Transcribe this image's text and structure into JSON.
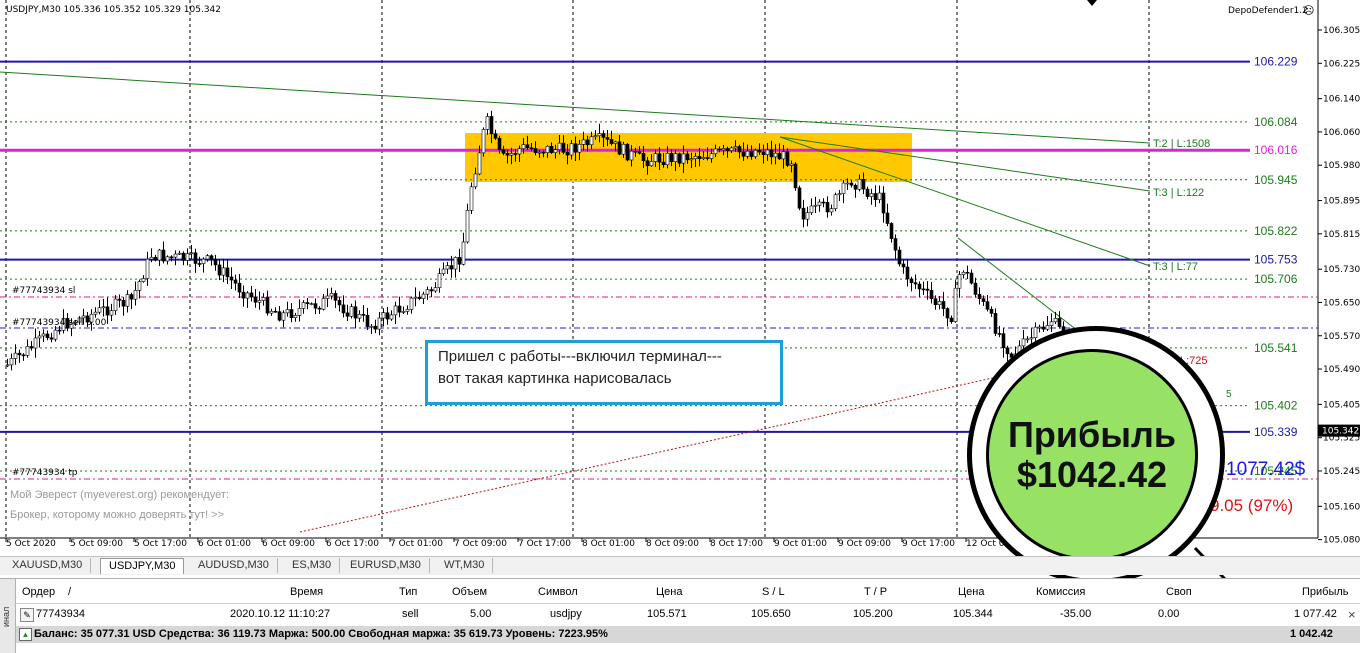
{
  "chart": {
    "header": "USDJPY,M30  105.336 105.352 105.329 105.342",
    "indicator": "DepoDefender1.2",
    "price_ticks": [
      "106.305",
      "106.225",
      "106.140",
      "106.060",
      "105.980",
      "105.895",
      "105.815",
      "105.730",
      "105.650",
      "105.570",
      "105.490",
      "105.405",
      "105.325",
      "105.245",
      "105.160",
      "105.080"
    ],
    "current_price": "105.342",
    "time_ticks": [
      "5 Oct 2020",
      "5 Oct 09:00",
      "5 Oct 17:00",
      "6 Oct 01:00",
      "6 Oct 09:00",
      "6 Oct 17:00",
      "7 Oct 01:00",
      "7 Oct 09:00",
      "7 Oct 17:00",
      "8 Oct 01:00",
      "8 Oct 09:00",
      "8 Oct 17:00",
      "9 Oct 01:00",
      "9 Oct 09:00",
      "9 Oct 17:00",
      "12 Oct 0"
    ],
    "level_labels": [
      "106.229",
      "106.084",
      "106.016",
      "105.945",
      "105.822",
      "105.753",
      "105.706",
      "105.541",
      "105.402",
      "105.339",
      "105.245"
    ],
    "trend_labels": [
      "T:2 | L:1508",
      "T:3 | L:122",
      "T:3 | L:77",
      "L:725"
    ],
    "order_labels": [
      "#77743934 sl",
      "#77743934 sell 5.00",
      "#77743934 tp"
    ],
    "ad_line1": "Мой Эверест (myeverest.org) рекомендует:",
    "ad_line2": "Брокер, которому можно доверять тут! >>",
    "overlay_profit": "1077.42$",
    "overlay_pct": "9.05 (97%)",
    "overlay_small": "9",
    "overlay_small2": "5",
    "colors": {
      "level_blue": "#1a1aa6",
      "level_magenta": "#e020e0",
      "zone": "#ffc800",
      "green_line": "#1b7a1b",
      "profit_green": "#97e164",
      "note_border": "#1a9fd8"
    }
  },
  "note": {
    "line1": "Пришел с работы---включил терминал---",
    "line2": "вот такая картинка нарисовалась"
  },
  "callout": {
    "line1": "Прибыль",
    "line2": "$1042.42"
  },
  "tabs": [
    "XAUUSD,M30",
    "USDJPY,M30",
    "AUDUSD,M30",
    "ES,M30",
    "EURUSD,M30",
    "WT,M30"
  ],
  "active_tab": "USDJPY,M30",
  "terminal": {
    "side_label": "инал",
    "columns": [
      "Ордер",
      "/",
      "Время",
      "Тип",
      "Объем",
      "Символ",
      "Цена",
      "S / L",
      "T / P",
      "Цена",
      "Комиссия",
      "Своп",
      "Прибыль"
    ],
    "row": {
      "order": "77743934",
      "time": "2020.10.12 11:10:27",
      "type": "sell",
      "volume": "5.00",
      "symbol": "usdjpy",
      "price": "105.571",
      "sl": "105.650",
      "tp": "105.200",
      "cur_price": "105.344",
      "commission": "-35.00",
      "swap": "0.00",
      "profit": "1 077.42"
    },
    "close_glyph": "×",
    "balance": "Баланс: 35 077.31 USD  Средства: 36 119.73  Маржа: 500.00  Свободная маржа: 35 619.73  Уровень: 7223.95%",
    "total": "1 042.42"
  }
}
